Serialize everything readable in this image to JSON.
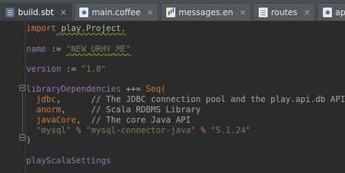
{
  "tabs": [
    {
      "label": "build.sbt",
      "icon": "sbt-file-icon",
      "active": true
    },
    {
      "label": "main.coffee",
      "icon": "coffee-file-icon"
    },
    {
      "label": "messages.en",
      "icon": "messages-file-icon"
    },
    {
      "label": "routes",
      "icon": "routes-file-icon"
    },
    {
      "label": "applicat",
      "icon": "application-file-icon"
    }
  ],
  "close_glyph": "×",
  "code": {
    "import_kw": "import",
    "import_path": " play.Project.",
    "name_id": "name",
    "name_op": " := ",
    "name_val": "\"NEW_URHY_ME\"",
    "version_id": "version",
    "version_op": " := ",
    "version_val": "\"1.0\"",
    "libdeps_id": "libraryDependencies",
    "libdeps_op": " ++= ",
    "libdeps_seq": "Seq(",
    "dep1_id": "jdbc",
    "dep1_sep": ",      ",
    "dep1_comment": "// The JDBC connection pool and the play.api.db API",
    "dep2_id": "anorm",
    "dep2_sep": ",     ",
    "dep2_comment": "// Scala RDBMS Library",
    "dep3_id": "javaCore",
    "dep3_sep": ",  ",
    "dep3_comment": "// The core Java API",
    "dep4_group": "\"mysql\"",
    "dep4_pct1": " % ",
    "dep4_artifact": "\"mysql-connector-java\"",
    "dep4_pct2": " % ",
    "dep4_version": "\"5.1.24\"",
    "close_paren": ")",
    "settings_id": "playScalaSettings"
  },
  "colors": {
    "background": "#2b2b2b",
    "keyword": "#cc7832",
    "string": "#6a8759",
    "identifier": "#9876aa",
    "comment": "#a8a8a8",
    "plain": "#a9b7c6"
  }
}
